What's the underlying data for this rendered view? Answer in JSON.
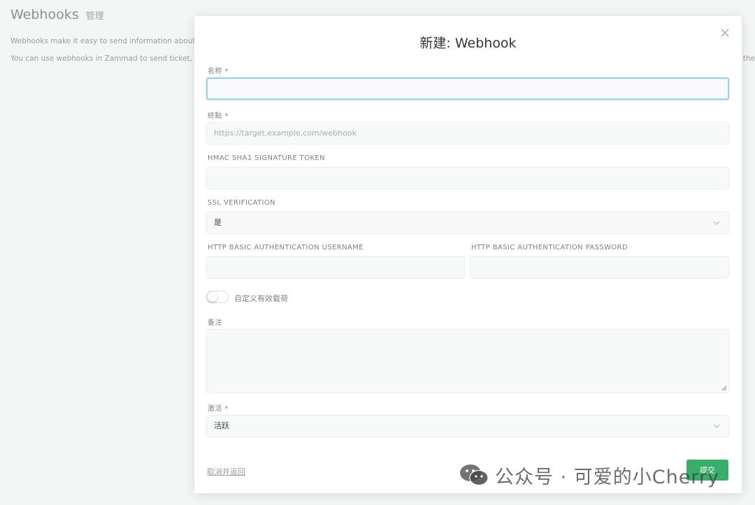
{
  "background": {
    "title": "Webhooks",
    "title_sub": "管理",
    "line1": "Webhooks make it easy to send information about e",
    "line2": "You can use webhooks in Zammad to send ticket, art",
    "line2_right": ", the"
  },
  "modal": {
    "title": "新建: Webhook",
    "fields": {
      "name": {
        "label": "名称 *",
        "value": ""
      },
      "endpoint": {
        "label": "終點 *",
        "placeholder": "https://target.example.com/webhook"
      },
      "hmac": {
        "label": "HMAC SHA1 SIGNATURE TOKEN",
        "value": ""
      },
      "ssl": {
        "label": "SSL VERIFICATION",
        "value": "是"
      },
      "http_user": {
        "label": "HTTP BASIC AUTHENTICATION USERNAME",
        "value": ""
      },
      "http_pass": {
        "label": "HTTP BASIC AUTHENTICATION PASSWORD",
        "value": ""
      },
      "custom_payload": {
        "label": "自定义有效载荷",
        "on": false
      },
      "note": {
        "label": "备注",
        "value": ""
      },
      "active": {
        "label": "激活 *",
        "value": "活跃"
      }
    },
    "cancel_label": "取消并返回",
    "submit_label": "提交"
  },
  "watermark": {
    "text": "公众号 · 可爱的小Cherry"
  },
  "colors": {
    "submit": "#38ae6a",
    "focus_border": "#9fd3e9"
  }
}
